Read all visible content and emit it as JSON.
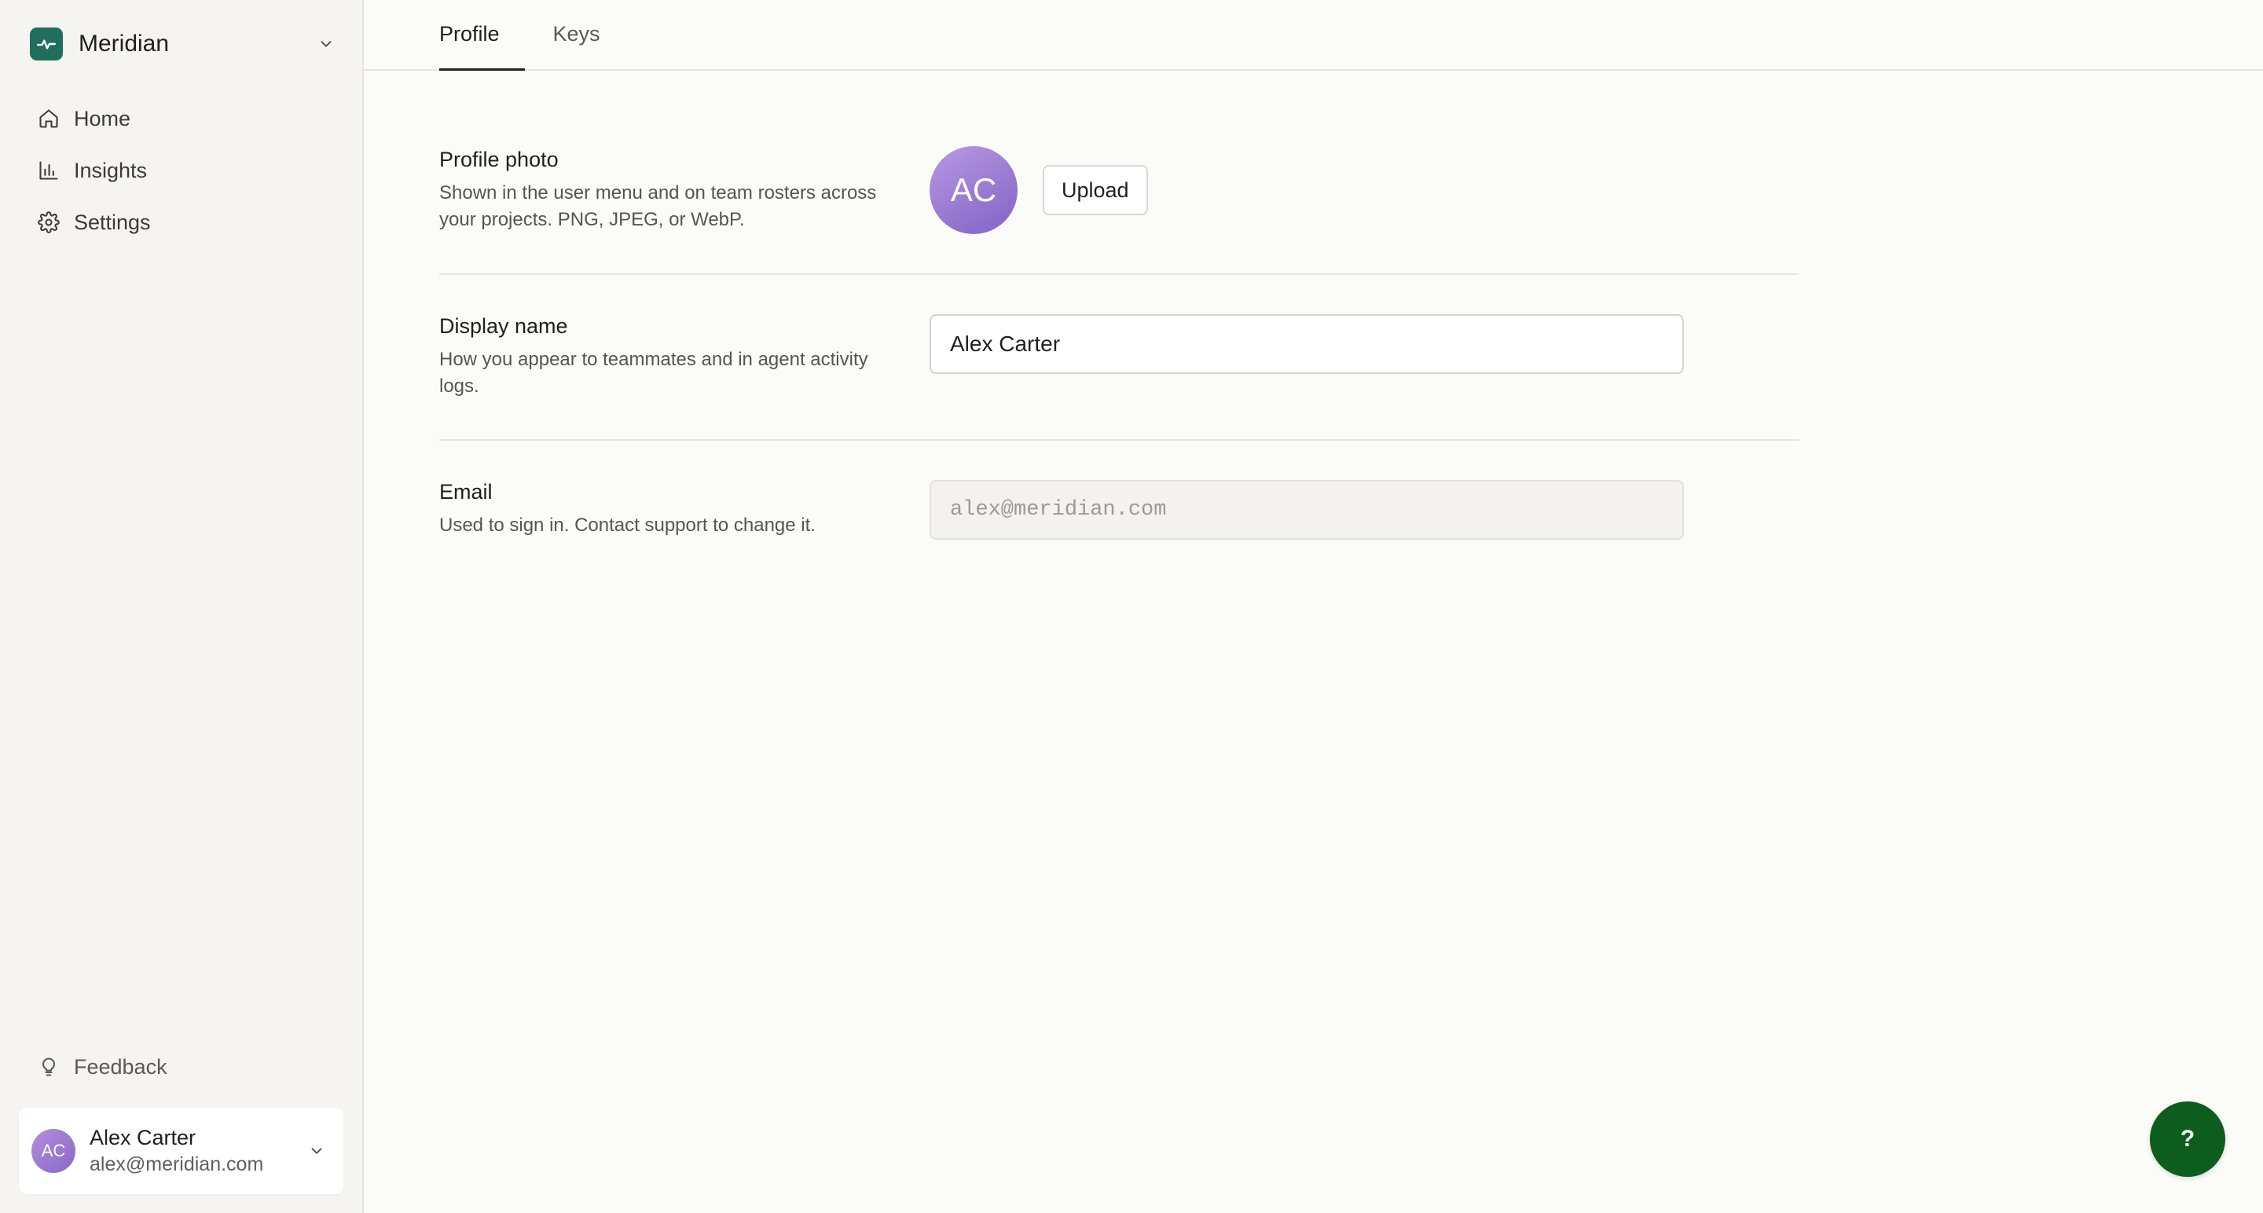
{
  "workspace": {
    "name": "Meridian",
    "logo_color": "#1f6f5c"
  },
  "sidebar": {
    "items": [
      {
        "label": "Home",
        "icon": "home-icon"
      },
      {
        "label": "Insights",
        "icon": "bar-chart-icon"
      },
      {
        "label": "Settings",
        "icon": "gear-icon"
      }
    ],
    "feedback_label": "Feedback"
  },
  "user": {
    "initials": "AC",
    "name": "Alex Carter",
    "email": "alex@meridian.com"
  },
  "tabs": [
    {
      "label": "Profile",
      "active": true
    },
    {
      "label": "Keys",
      "active": false
    }
  ],
  "profile": {
    "photo": {
      "title": "Profile photo",
      "description": "Shown in the user menu and on team rosters across your projects. PNG, JPEG, or WebP.",
      "avatar_initials": "AC",
      "upload_label": "Upload"
    },
    "display_name": {
      "title": "Display name",
      "description": "How you appear to teammates and in agent activity logs.",
      "value": "Alex Carter"
    },
    "email": {
      "title": "Email",
      "description": "Used to sign in. Contact support to change it.",
      "value": "alex@meridian.com"
    }
  },
  "help": {
    "label": "?",
    "color": "#0d5d1f"
  }
}
